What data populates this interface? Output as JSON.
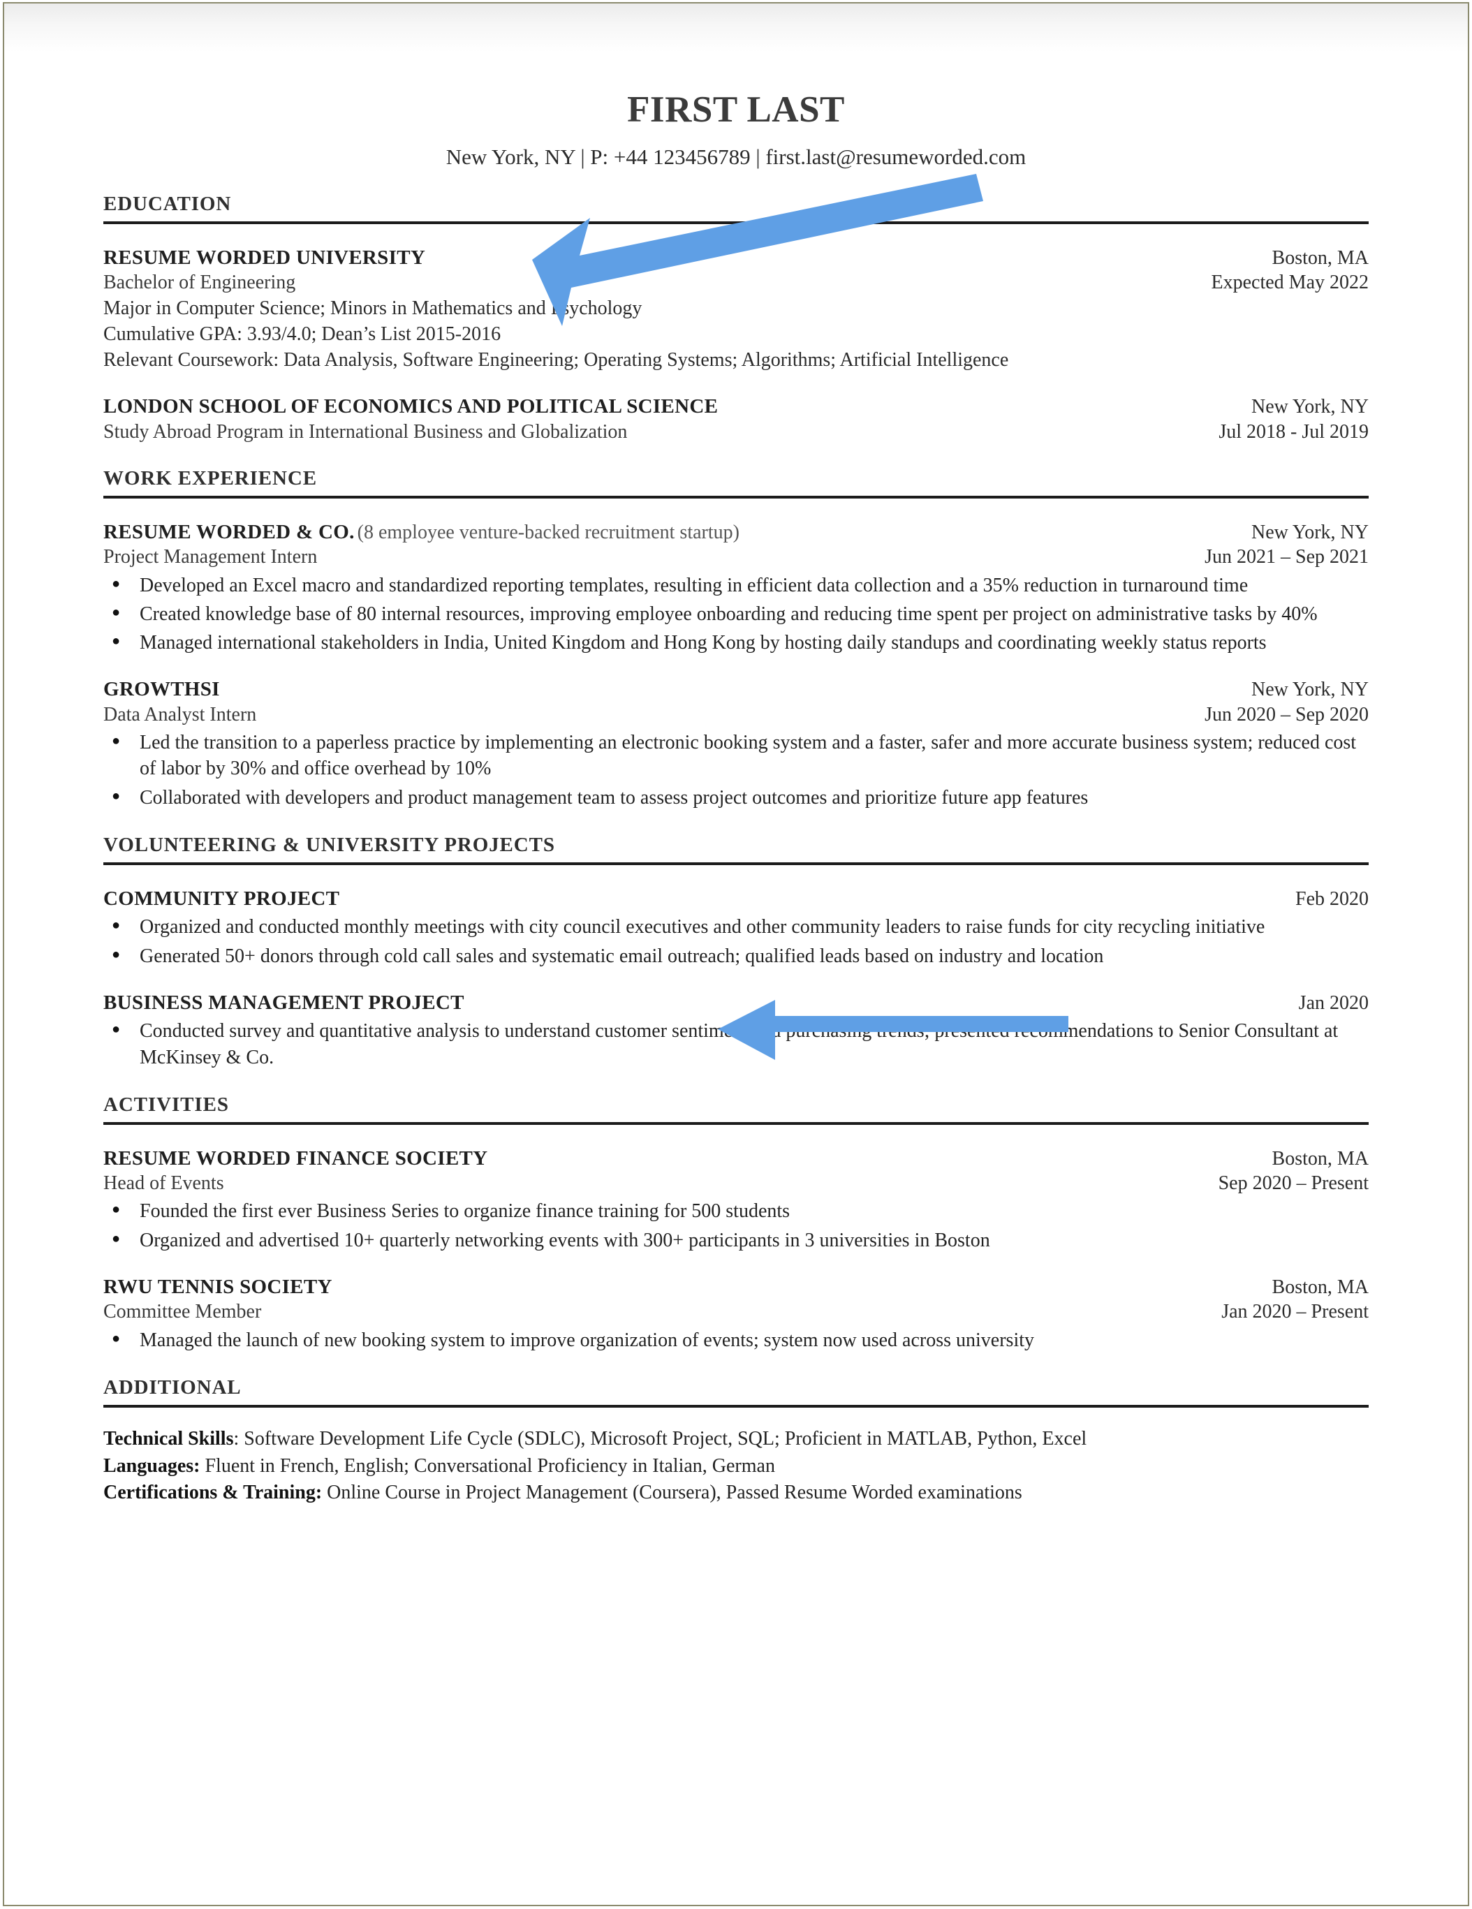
{
  "document": {
    "type": "resume",
    "accent_color": "#5f9fe5",
    "page_border_color": "#8b8a6e",
    "rule_color": "#1b1b1b"
  },
  "header": {
    "name": "FIRST LAST",
    "contact": "New York, NY  |  P: +44 123456789  |  first.last@resumeworded.com"
  },
  "sections": {
    "education": {
      "title": "EDUCATION",
      "entries": [
        {
          "org": "RESUME WORDED UNIVERSITY",
          "location": "Boston, MA",
          "role": "Bachelor of Engineering",
          "dates": "Expected May 2022",
          "lines": [
            "Major in Computer Science; Minors in Mathematics and Psychology",
            "Cumulative GPA: 3.93/4.0; Dean’s List 2015-2016",
            "Relevant Coursework: Data Analysis, Software Engineering; Operating Systems; Algorithms; Artificial Intelligence"
          ]
        },
        {
          "org": "LONDON SCHOOL OF ECONOMICS AND POLITICAL SCIENCE",
          "location": "New York, NY",
          "role": "Study Abroad Program in International Business and Globalization",
          "dates": "Jul 2018 - Jul 2019",
          "lines": []
        }
      ]
    },
    "work_experience": {
      "title": "WORK EXPERIENCE",
      "entries": [
        {
          "org": "RESUME WORDED & CO.",
          "org_note": "(8 employee venture-backed recruitment startup)",
          "location": "New York, NY",
          "role": "Project Management Intern",
          "dates": "Jun 2021 – Sep 2021",
          "bullets": [
            "Developed an Excel macro and standardized reporting templates, resulting in efficient data collection and a 35% reduction in turnaround time",
            "Created knowledge base of 80 internal resources, improving employee onboarding and reducing time spent per project on administrative tasks by 40%",
            "Managed international stakeholders in India, United Kingdom and Hong Kong by hosting daily standups and coordinating weekly status reports"
          ]
        },
        {
          "org": "GROWTHSI",
          "org_note": "",
          "location": "New York, NY",
          "role": "Data Analyst Intern",
          "dates": "Jun 2020 – Sep 2020",
          "bullets": [
            "Led the transition to a paperless practice by implementing an electronic booking system and a faster, safer and more accurate business system; reduced cost of labor by 30% and office overhead by 10%",
            "Collaborated with developers and product management team to assess project outcomes and prioritize future app features"
          ]
        }
      ]
    },
    "volunteering": {
      "title": "VOLUNTEERING & UNIVERSITY PROJECTS",
      "entries": [
        {
          "org": "COMMUNITY PROJECT",
          "dates": "Feb 2020",
          "bullets": [
            "Organized and conducted monthly meetings with city council executives and other community leaders to raise funds for city recycling initiative",
            "Generated 50+ donors through cold call sales and systematic email outreach; qualified leads based on industry and location"
          ]
        },
        {
          "org": "BUSINESS MANAGEMENT PROJECT",
          "dates": "Jan 2020",
          "bullets": [
            "Conducted survey and quantitative analysis to understand customer sentiment and purchasing trends; presented recommendations to Senior Consultant at McKinsey & Co."
          ]
        }
      ]
    },
    "activities": {
      "title": "ACTIVITIES",
      "entries": [
        {
          "org": "RESUME WORDED FINANCE SOCIETY",
          "location": "Boston, MA",
          "role": "Head of Events",
          "dates": "Sep 2020 – Present",
          "bullets": [
            "Founded the first ever Business Series to organize finance training for 500 students",
            "Organized and advertised 10+ quarterly networking events with 300+ participants in 3 universities in Boston"
          ]
        },
        {
          "org": "RWU TENNIS SOCIETY",
          "location": "Boston, MA",
          "role": "Committee Member",
          "dates": "Jan 2020 – Present",
          "bullets": [
            "Managed the launch of new booking system to improve organization of events; system now used across university"
          ]
        }
      ]
    },
    "additional": {
      "title": "ADDITIONAL",
      "lines": [
        {
          "label": "Technical Skills",
          "separator": ": ",
          "value": "Software Development Life Cycle (SDLC), Microsoft Project, SQL; Proficient in MATLAB, Python, Excel"
        },
        {
          "label": "Languages:",
          "separator": " ",
          "value": "Fluent in French, English; Conversational Proficiency in Italian, German"
        },
        {
          "label": "Certifications & Training:",
          "separator": " ",
          "value": "Online Course in Project Management (Coursera), Passed Resume Worded examinations"
        }
      ]
    }
  },
  "annotations": [
    {
      "name": "arrow-to-university-name",
      "color": "#5f9fe5"
    },
    {
      "name": "arrow-to-volunteering-heading",
      "color": "#5f9fe5"
    }
  ]
}
